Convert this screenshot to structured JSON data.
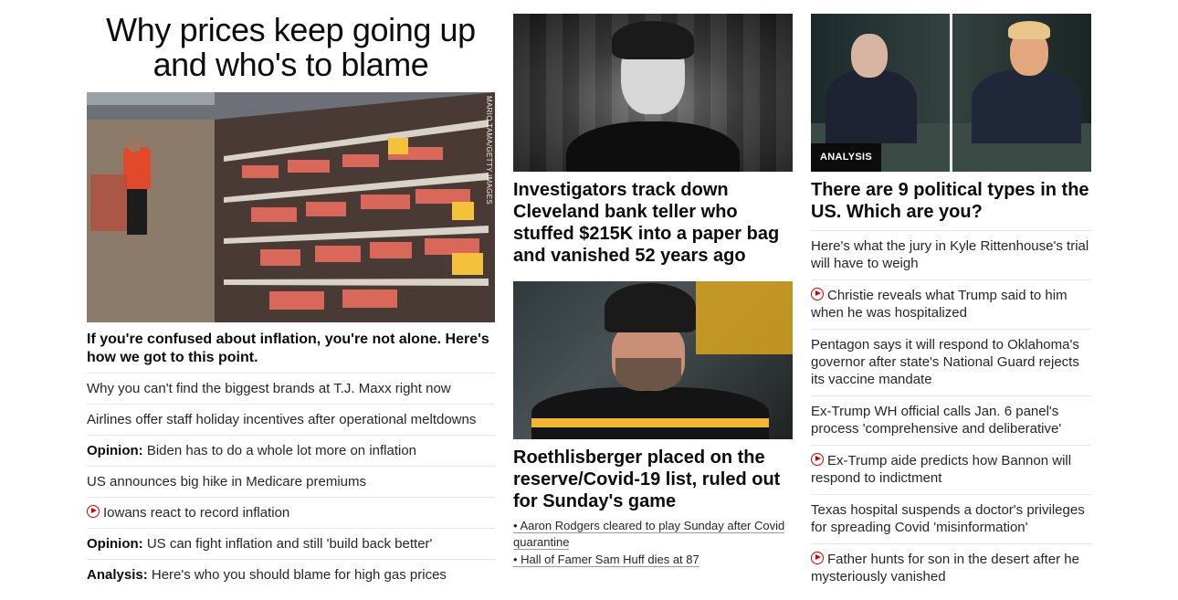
{
  "left": {
    "title": "Why prices keep going up and who's to blame",
    "hero_credit": "MARIO TAMA/GETTY IMAGES",
    "hero_caption": "If you're confused about inflation, you're not alone. Here's how we got to this point.",
    "links": [
      {
        "kicker": "",
        "text": "Why you can't find the biggest brands at T.J. Maxx right now",
        "video": false
      },
      {
        "kicker": "",
        "text": "Airlines offer staff holiday incentives after operational meltdowns",
        "video": false
      },
      {
        "kicker": "Opinion:",
        "text": "Biden has to do a whole lot more on inflation",
        "video": false
      },
      {
        "kicker": "",
        "text": "US announces big hike in Medicare premiums",
        "video": false
      },
      {
        "kicker": "",
        "text": "Iowans react to record inflation",
        "video": true
      },
      {
        "kicker": "Opinion:",
        "text": "US can fight inflation and still 'build back better'",
        "video": false
      },
      {
        "kicker": "Analysis:",
        "text": "Here's who you should blame for high gas prices",
        "video": false
      }
    ]
  },
  "middle": {
    "story1": {
      "headline": "Investigators track down Cleveland bank teller who stuffed $215K into a paper bag and vanished 52 years ago"
    },
    "story2": {
      "headline": "Roethlisberger placed on the reserve/Covid-19 list, ruled out for Sunday's game",
      "sublinks": [
        "• Aaron Rodgers cleared to play Sunday after Covid quarantine",
        "• Hall of Famer Sam Huff dies at 87"
      ]
    }
  },
  "right": {
    "badge": "ANALYSIS",
    "headline": "There are 9 political types in the US. Which are you?",
    "links": [
      {
        "text": "Here's what the jury in Kyle Rittenhouse's trial will have to weigh",
        "video": false
      },
      {
        "text": "Christie reveals what Trump said to him when he was hospitalized",
        "video": true
      },
      {
        "text": "Pentagon says it will respond to Oklahoma's governor after state's National Guard rejects its vaccine mandate",
        "video": false
      },
      {
        "text": "Ex-Trump WH official calls Jan. 6 panel's process 'comprehensive and deliberative'",
        "video": false
      },
      {
        "text": "Ex-Trump aide predicts how Bannon will respond to indictment",
        "video": true
      },
      {
        "text": "Texas hospital suspends a doctor's privileges for spreading Covid 'misinformation'",
        "video": false
      },
      {
        "text": "Father hunts for son in the desert after he mysteriously vanished",
        "video": true
      }
    ]
  },
  "colors": {
    "accent_red": "#cc0000",
    "text": "#0c0c0c",
    "divider": "#e6e6e6"
  }
}
